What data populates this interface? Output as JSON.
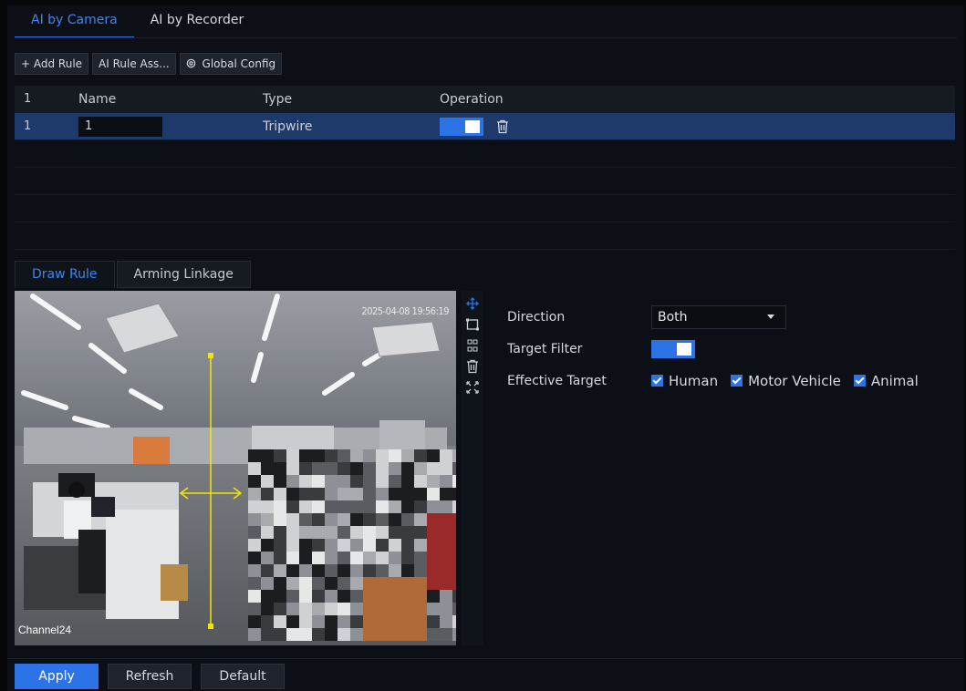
{
  "top_tabs": [
    {
      "label": "AI by Camera",
      "active": true
    },
    {
      "label": "AI by Recorder",
      "active": false
    }
  ],
  "toolbar": {
    "add_rule": "+ Add Rule",
    "ai_rule_assistant": "AI Rule Ass...",
    "global_config": "Global Config"
  },
  "rule_table": {
    "headers": {
      "index": "1",
      "name": "Name",
      "type": "Type",
      "operation": "Operation"
    },
    "rows": [
      {
        "index": "1",
        "name": "1",
        "type": "Tripwire",
        "enabled": true
      }
    ]
  },
  "sub_tabs": [
    {
      "label": "Draw Rule",
      "active": true
    },
    {
      "label": "Arming Linkage",
      "active": false
    }
  ],
  "video": {
    "timestamp": "2025-04-08 19:56:19",
    "channel": "Channel24"
  },
  "draw_tools": [
    "move-icon",
    "draw-rect-icon",
    "draw-line-icon",
    "delete-icon",
    "fullscreen-icon"
  ],
  "settings": {
    "direction_label": "Direction",
    "direction_value": "Both",
    "target_filter_label": "Target Filter",
    "target_filter_on": true,
    "effective_target_label": "Effective Target",
    "targets": [
      {
        "label": "Human",
        "checked": true
      },
      {
        "label": "Motor Vehicle",
        "checked": true
      },
      {
        "label": "Animal",
        "checked": true
      }
    ]
  },
  "bottom": {
    "apply": "Apply",
    "refresh": "Refresh",
    "default": "Default"
  },
  "colors": {
    "accent": "#2b73e6",
    "background": "#0c1016",
    "selected_row": "#1e3a6a",
    "tripwire": "#f2e600"
  }
}
